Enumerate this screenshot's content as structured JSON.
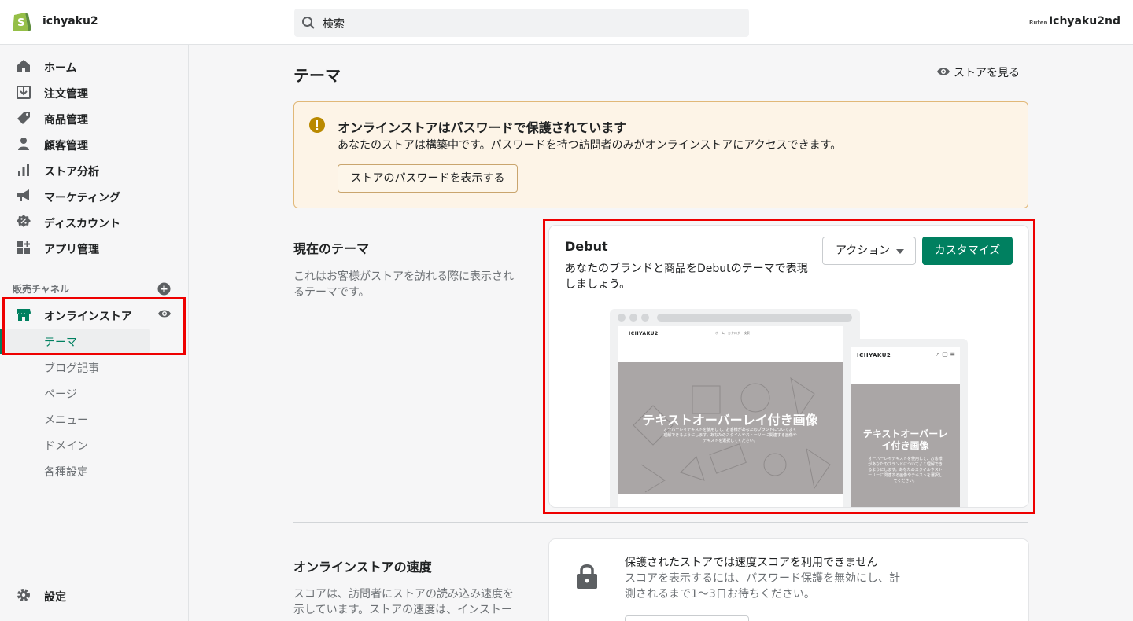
{
  "header": {
    "store_name": "ichyaku2",
    "search_placeholder": "検索",
    "account_logo": "Ruten",
    "account_name": "Ichyaku2nd"
  },
  "sidebar": {
    "items": [
      {
        "label": "ホーム",
        "icon": "home-icon"
      },
      {
        "label": "注文管理",
        "icon": "orders-icon"
      },
      {
        "label": "商品管理",
        "icon": "tag-icon"
      },
      {
        "label": "顧客管理",
        "icon": "person-icon"
      },
      {
        "label": "ストア分析",
        "icon": "analytics-icon"
      },
      {
        "label": "マーケティング",
        "icon": "megaphone-icon"
      },
      {
        "label": "ディスカウント",
        "icon": "discount-icon"
      },
      {
        "label": "アプリ管理",
        "icon": "apps-icon"
      }
    ],
    "channels_title": "販売チャネル",
    "online_store": "オンラインストア",
    "sub_items": [
      "テーマ",
      "ブログ記事",
      "ページ",
      "メニュー",
      "ドメイン",
      "各種設定"
    ],
    "settings": "設定"
  },
  "main": {
    "title": "テーマ",
    "view_store": "ストアを見る",
    "banner": {
      "title": "オンラインストアはパスワードで保護されています",
      "text": "あなたのストアは構築中です。パスワードを持つ訪問者のみがオンラインストアにアクセスできます。",
      "button": "ストアのパスワードを表示する"
    },
    "current_theme": {
      "title": "現在のテーマ",
      "desc_line1": "これはお客様がストアを訪れる際に表示され",
      "desc_line2": "るテーマです。",
      "name": "Debut",
      "desc_card_line1": "あなたのブランドと商品をDebutのテーマで表現",
      "desc_card_line2": "しましょう。",
      "action_button": "アクション",
      "customize_button": "カスタマイズ",
      "preview": {
        "brand": "ICHYAKU2",
        "menu": "ホーム　カタログ　検索",
        "hero_title": "テキストオーバーレイ付き画像",
        "hero_sub_line1": "オーバーレイテキストを使用して、お客様があなたのブランドについてよく",
        "hero_sub_line2": "理解できるようにします。あなたのスタイルやストーリーに関連する画像や",
        "hero_sub_line3": "テキストを選択してください。",
        "mobile_hero_title_line1": "テキストオーバーレ",
        "mobile_hero_title_line2": "イ付き画像",
        "mobile_sub_line1": "オーバーレイテキストを使用して、お客様",
        "mobile_sub_line2": "があなたのブランドについてよく理解でき",
        "mobile_sub_line3": "るようにします。あなたのスタイルやスト",
        "mobile_sub_line4": "ーリーに関連する画像やテキストを選択し",
        "mobile_sub_line5": "てください。"
      }
    },
    "speed": {
      "title": "オンラインストアの速度",
      "desc_line1": "スコアは、訪問者にストアの読み込み速度を",
      "desc_line2": "示しています。ストアの速度は、インストー",
      "card_title": "保護されたストアでは速度スコアを利用できません",
      "card_text_line1": "スコアを表示するには、パスワード保護を無効にし、計",
      "card_text_line2": "測されるまで1〜3日お待ちください。"
    }
  },
  "colors": {
    "accent": "#008060",
    "warning_bg": "#fdf4e7",
    "highlight": "#e00000"
  }
}
